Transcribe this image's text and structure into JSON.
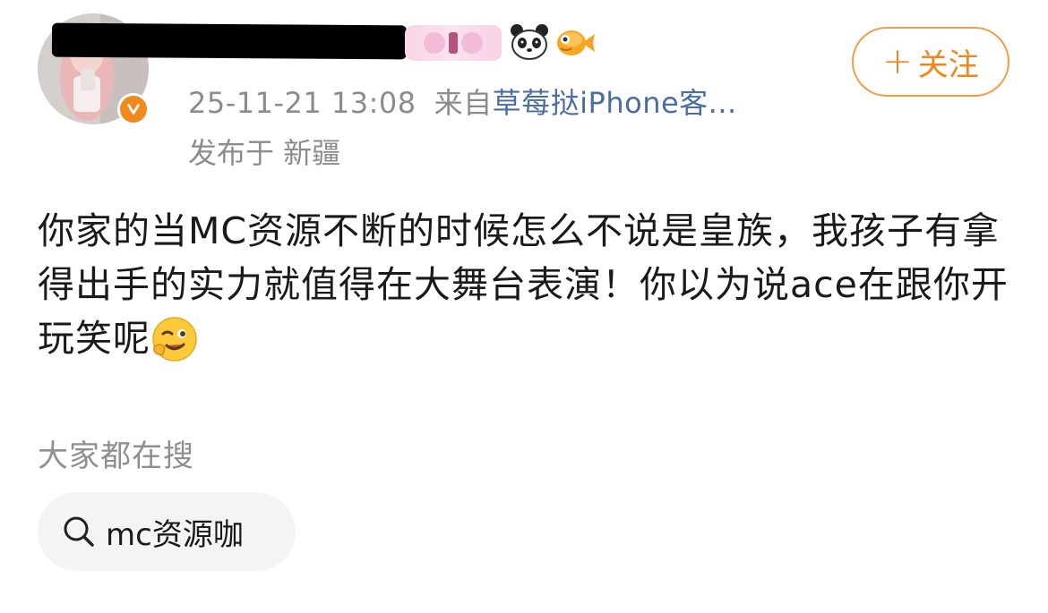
{
  "author": {
    "source_prefix": "来自",
    "source_link": "草莓挞iPhone客...",
    "timestamp": "25-11-21 13:08",
    "location": "发布于 新疆",
    "follow_label": "关注",
    "follow_icon": "+"
  },
  "post": {
    "text": "你家的当MC资源不断的时候怎么不说是皇族，我孩子有拿得出手的实力就值得在大舞台表演！你以为说ace在跟你开玩笑呢",
    "emoji": "wink-emoji"
  },
  "trending": {
    "label": "大家都在搜",
    "chips": [
      {
        "label": "mc资源咖",
        "icon": "search-icon"
      }
    ]
  },
  "colors": {
    "accent_orange": "#f0851d",
    "link_blue": "#4a6da4",
    "muted_gray": "#8c8c8c"
  }
}
